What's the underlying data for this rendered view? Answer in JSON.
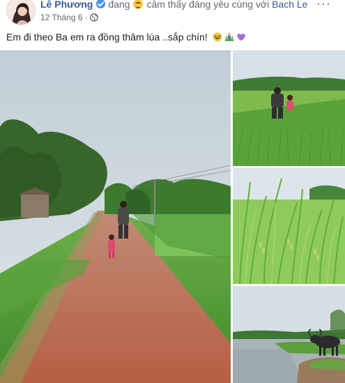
{
  "post": {
    "author_name": "Lê Phương",
    "feeling_prefix": "đang",
    "feeling_suffix": "cảm thấy đáng yêu cùng với",
    "tagged_person": "Bach Le",
    "date": "12 Tháng 6",
    "separator": "·",
    "more_label": "···",
    "caption": "Em đi theo Ba em ra đồng thăm lúa ..sắp chín!",
    "icons": {
      "verified": "verified-badge-icon",
      "feeling": "smiling-face-icon",
      "privacy": "globe-icon",
      "caption_emojis": [
        "laughing-face-icon",
        "person-in-field-icon",
        "purple-heart-icon"
      ]
    }
  },
  "photos": [
    {
      "name": "dirt-road-photo",
      "alt": "father and child walking on dirt road between fields"
    },
    {
      "name": "rice-field-people-photo",
      "alt": "man and child in green rice field"
    },
    {
      "name": "rice-closeup-photo",
      "alt": "close-up of rice stalks"
    },
    {
      "name": "buffalo-river-photo",
      "alt": "water buffalo by the river"
    }
  ],
  "colors": {
    "link": "#385898",
    "secondary_text": "#606770",
    "verified": "#4a8ef0",
    "sky": "#c9d6df",
    "grass": "#5ea83d",
    "road": "#b8694d"
  }
}
